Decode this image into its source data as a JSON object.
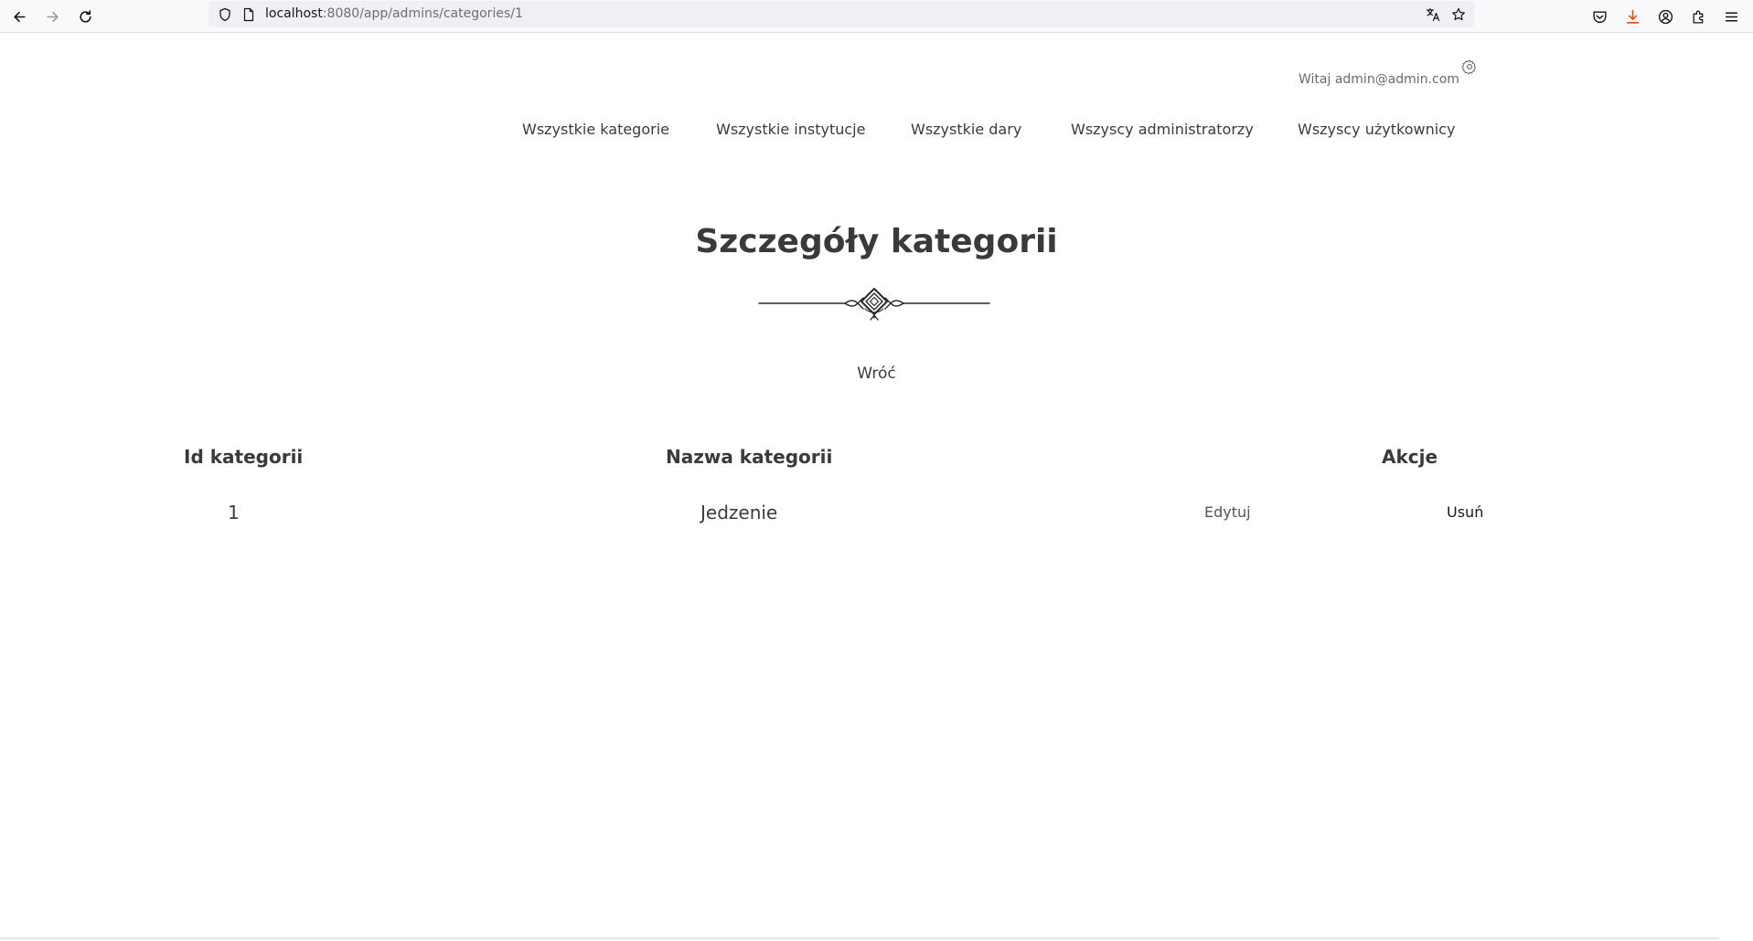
{
  "browser": {
    "url_host": "localhost",
    "url_path": ":8080/app/admins/categories/1",
    "icons": {
      "back": "arrow-left-icon",
      "forward": "arrow-right-icon",
      "reload": "reload-icon",
      "shield": "shield-icon",
      "page": "page-icon",
      "translate": "translate-icon",
      "bookmark": "star-icon",
      "pocket": "pocket-icon",
      "downloads": "download-icon",
      "account": "account-icon",
      "extensions": "extensions-icon",
      "menu": "hamburger-menu-icon"
    },
    "download_accent": "#e8541c"
  },
  "header": {
    "greeting": "Witaj admin@admin.com",
    "settings_icon": "gear-icon"
  },
  "nav": {
    "items": [
      {
        "label": "Wszystkie kategorie"
      },
      {
        "label": "Wszystkie instytucje"
      },
      {
        "label": "Wszystkie dary"
      },
      {
        "label": "Wszyscy administratorzy"
      },
      {
        "label": "Wszyscy użytkownicy"
      }
    ]
  },
  "main": {
    "title": "Szczegóły kategorii",
    "ornament_icon": "decorative-divider-icon",
    "back_label": "Wróć"
  },
  "table": {
    "headers": [
      "Id kategorii",
      "Nazwa kategorii",
      "Akcje"
    ],
    "rows": [
      {
        "id": "1",
        "name": "Jedzenie",
        "edit_label": "Edytuj",
        "delete_label": "Usuń"
      }
    ]
  }
}
